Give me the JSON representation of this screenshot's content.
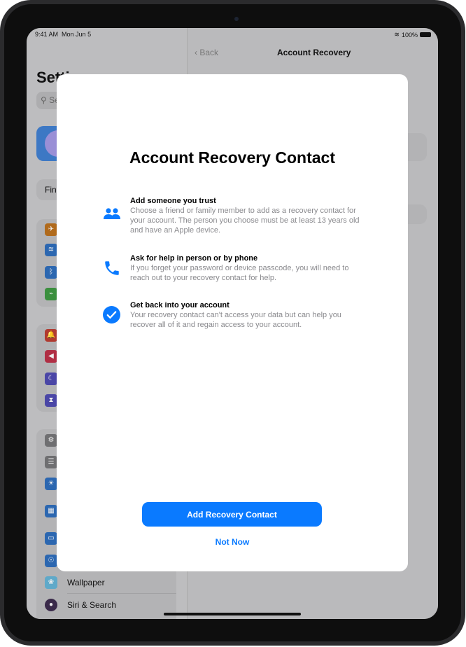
{
  "status": {
    "time": "9:41 AM",
    "date": "Mon Jun 5",
    "battery": "100%"
  },
  "nav": {
    "back": "Back",
    "title": "Account Recovery"
  },
  "sidebar": {
    "title": "Settings",
    "search_placeholder": "Search",
    "find": "Find",
    "items": [
      {
        "label": "Wallpaper"
      },
      {
        "label": "Siri & Search"
      }
    ]
  },
  "modal": {
    "title": "Account Recovery Contact",
    "features": [
      {
        "icon": "people-icon",
        "heading": "Add someone you trust",
        "body": "Choose a friend or family member to add as a recovery contact for your account. The person you choose must be at least 13 years old and have an Apple device."
      },
      {
        "icon": "phone-icon",
        "heading": "Ask for help in person or by phone",
        "body": "If you forget your password or device passcode, you will need to reach out to your recovery contact for help."
      },
      {
        "icon": "checkmark-circle-icon",
        "heading": "Get back into your account",
        "body": "Your recovery contact can't access your data but can help you recover all of it and regain access to your account."
      }
    ],
    "primary": "Add Recovery Contact",
    "secondary": "Not Now"
  },
  "colors": {
    "accent": "#0a7aff"
  }
}
